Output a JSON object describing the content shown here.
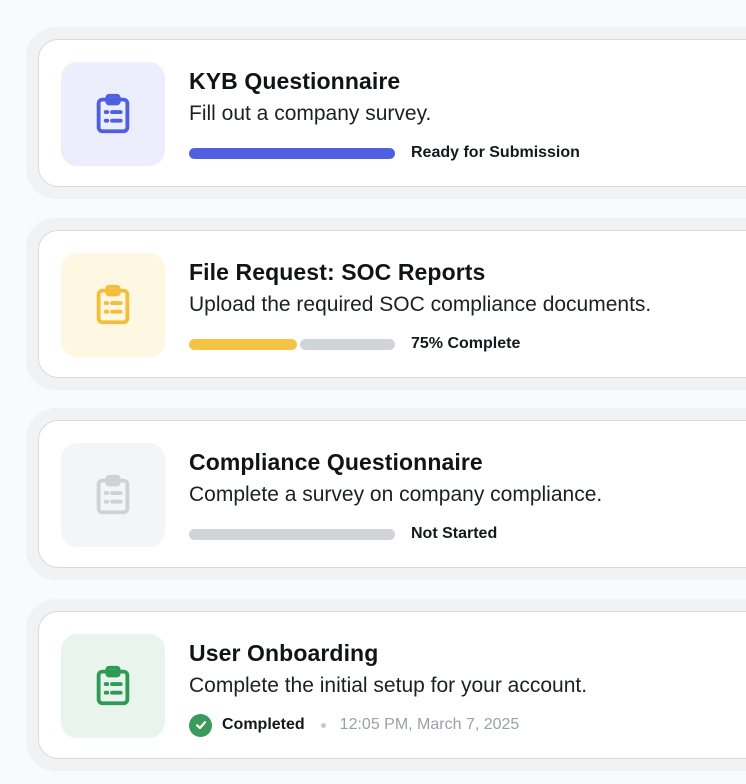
{
  "tasks": [
    {
      "title": "KYB Questionnaire",
      "description": "Fill out a company survey.",
      "status": "Ready for Submission",
      "progress": 1.0,
      "progress_color": "#4f5fe0",
      "icon": "clipboard-list-icon",
      "icon_color": "#4f5fe0",
      "tile_bg": "#eceefd"
    },
    {
      "title": "File Request: SOC Reports",
      "description": "Upload the required SOC compliance documents.",
      "status": "75% Complete",
      "progress": 0.75,
      "progress_color": "#f5c244",
      "icon": "clipboard-list-icon",
      "icon_color": "#f3bf3a",
      "tile_bg": "#fef7e2"
    },
    {
      "title": "Compliance Questionnaire",
      "description": "Complete a survey on company compliance.",
      "status": "Not Started",
      "progress": 0.0,
      "progress_color": "#d0d4d9",
      "icon": "clipboard-list-icon",
      "icon_color": "#ced2d7",
      "tile_bg": "#f4f5f7"
    },
    {
      "title": "User Onboarding",
      "description": "Complete the initial setup for your account.",
      "status": "Completed",
      "completed_at": "12:05 PM, March 7, 2025",
      "icon": "clipboard-list-icon",
      "icon_color": "#2f9a55",
      "tile_bg": "#e9f5ec",
      "check_color": "#3a9a5c"
    }
  ]
}
